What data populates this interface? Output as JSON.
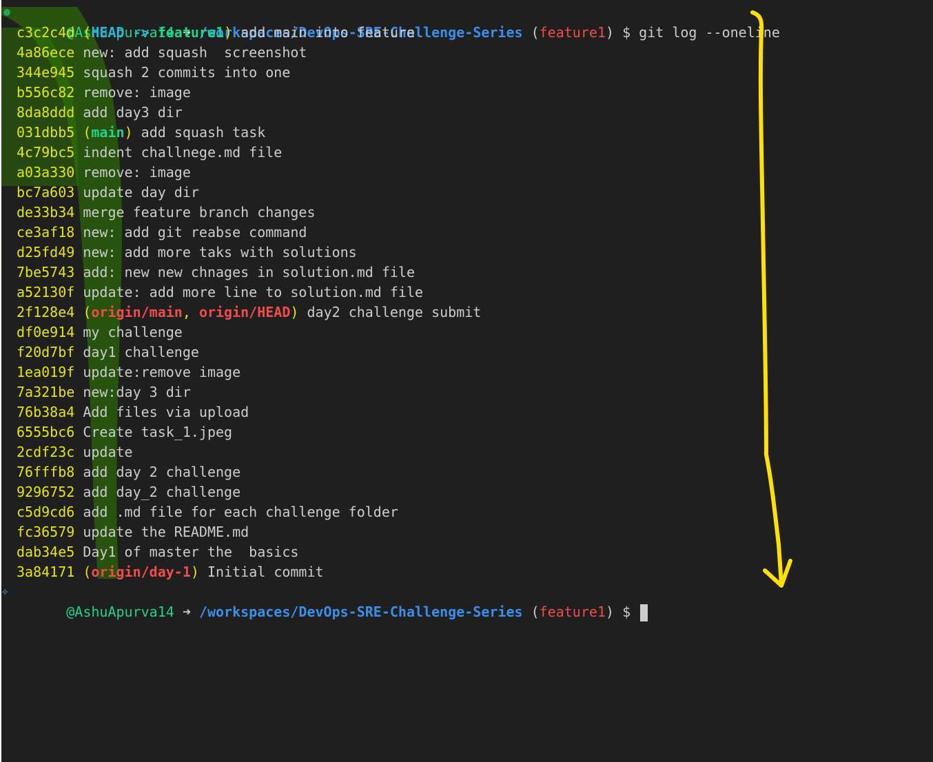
{
  "prompt": {
    "user": "@AshuApurva14",
    "arrow": "➜",
    "path": "/workspaces/DevOps-SRE-Challenge-Series",
    "branch": "feature1",
    "symbol": "$",
    "command": "git log --oneline"
  },
  "commits": [
    {
      "hash": "c3c2c4d",
      "refs": [
        {
          "text": "HEAD -> ",
          "kind": "head"
        },
        {
          "text": "feature1",
          "kind": "branch"
        }
      ],
      "message": "add main into feature"
    },
    {
      "hash": "4a86ece",
      "refs": [],
      "message": "new: add squash  screenshot"
    },
    {
      "hash": "344e945",
      "refs": [],
      "message": "squash 2 commits into one"
    },
    {
      "hash": "b556c82",
      "refs": [],
      "message": "remove: image"
    },
    {
      "hash": "8da8ddd",
      "refs": [],
      "message": "add day3 dir"
    },
    {
      "hash": "031dbb5",
      "refs": [
        {
          "text": "main",
          "kind": "branch"
        }
      ],
      "message": "add squash task"
    },
    {
      "hash": "4c79bc5",
      "refs": [],
      "message": "indent challnege.md file"
    },
    {
      "hash": "a03a330",
      "refs": [],
      "message": "remove: image"
    },
    {
      "hash": "bc7a603",
      "refs": [],
      "message": "update day dir"
    },
    {
      "hash": "de33b34",
      "refs": [],
      "message": "merge feature branch changes"
    },
    {
      "hash": "ce3af18",
      "refs": [],
      "message": "new: add git reabse command"
    },
    {
      "hash": "d25fd49",
      "refs": [],
      "message": "new: add more taks with solutions"
    },
    {
      "hash": "7be5743",
      "refs": [],
      "message": "add: new new chnages in solution.md file"
    },
    {
      "hash": "a52130f",
      "refs": [],
      "message": "update: add more line to solution.md file"
    },
    {
      "hash": "2f128e4",
      "refs": [
        {
          "text": "origin/main",
          "kind": "remote"
        },
        {
          "text": ", ",
          "kind": "sep"
        },
        {
          "text": "origin/HEAD",
          "kind": "remote"
        }
      ],
      "message": "day2 challenge submit"
    },
    {
      "hash": "df0e914",
      "refs": [],
      "message": "my challenge"
    },
    {
      "hash": "f20d7bf",
      "refs": [],
      "message": "day1 challenge"
    },
    {
      "hash": "1ea019f",
      "refs": [],
      "message": "update:remove image"
    },
    {
      "hash": "7a321be",
      "refs": [],
      "message": "new:day 3 dir"
    },
    {
      "hash": "76b38a4",
      "refs": [],
      "message": "Add files via upload"
    },
    {
      "hash": "6555bc6",
      "refs": [],
      "message": "Create task_1.jpeg"
    },
    {
      "hash": "2cdf23c",
      "refs": [],
      "message": "update"
    },
    {
      "hash": "76fffb8",
      "refs": [],
      "message": "add day 2 challenge"
    },
    {
      "hash": "9296752",
      "refs": [],
      "message": "add day_2 challenge"
    },
    {
      "hash": "c5d9cd6",
      "refs": [],
      "message": "add .md file for each challenge folder"
    },
    {
      "hash": "fc36579",
      "refs": [],
      "message": "update the README.md"
    },
    {
      "hash": "dab34e5",
      "refs": [],
      "message": "Day1 of master the  basics"
    },
    {
      "hash": "3a84171",
      "refs": [
        {
          "text": "origin/day-1",
          "kind": "remote"
        }
      ],
      "message": "Initial commit"
    }
  ],
  "colors": {
    "background": "#1f1f1f",
    "hash": "#e5e510",
    "user": "#23d18b",
    "path": "#3b8eea",
    "branch": "#f14c4c",
    "head": "#29b8db",
    "annotation": "#ffe100",
    "highlighter": "#2e8b00"
  },
  "icons": {
    "prompt_status": "green-dot-icon",
    "prompt_sparkle": "sparkle-icon",
    "annotation": "down-arrow-annotation"
  }
}
